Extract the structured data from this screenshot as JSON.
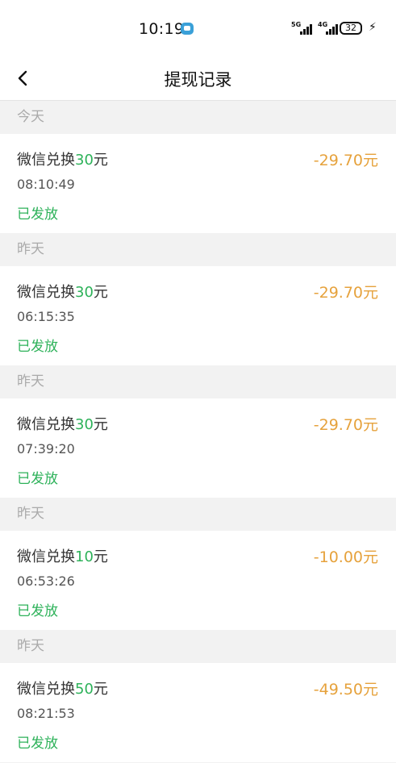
{
  "status_bar": {
    "time": "10:19",
    "network1": "5G",
    "network2": "4G",
    "battery": "32"
  },
  "nav": {
    "title": "提现记录"
  },
  "colors": {
    "green": "#2eb25a",
    "amount": "#e6a23c"
  },
  "records": [
    {
      "date_group": "今天",
      "title_prefix": "微信兑换",
      "title_num": "30",
      "title_suffix": "元",
      "time": "08:10:49",
      "status": "已发放",
      "amount": "-29.70元"
    },
    {
      "date_group": "昨天",
      "title_prefix": "微信兑换",
      "title_num": "30",
      "title_suffix": "元",
      "time": "06:15:35",
      "status": "已发放",
      "amount": "-29.70元"
    },
    {
      "date_group": "昨天",
      "title_prefix": "微信兑换",
      "title_num": "30",
      "title_suffix": "元",
      "time": "07:39:20",
      "status": "已发放",
      "amount": "-29.70元"
    },
    {
      "date_group": "昨天",
      "title_prefix": "微信兑换",
      "title_num": "10",
      "title_suffix": "元",
      "time": "06:53:26",
      "status": "已发放",
      "amount": "-10.00元"
    },
    {
      "date_group": "昨天",
      "title_prefix": "微信兑换",
      "title_num": "50",
      "title_suffix": "元",
      "time": "08:21:53",
      "status": "已发放",
      "amount": "-49.50元"
    }
  ]
}
